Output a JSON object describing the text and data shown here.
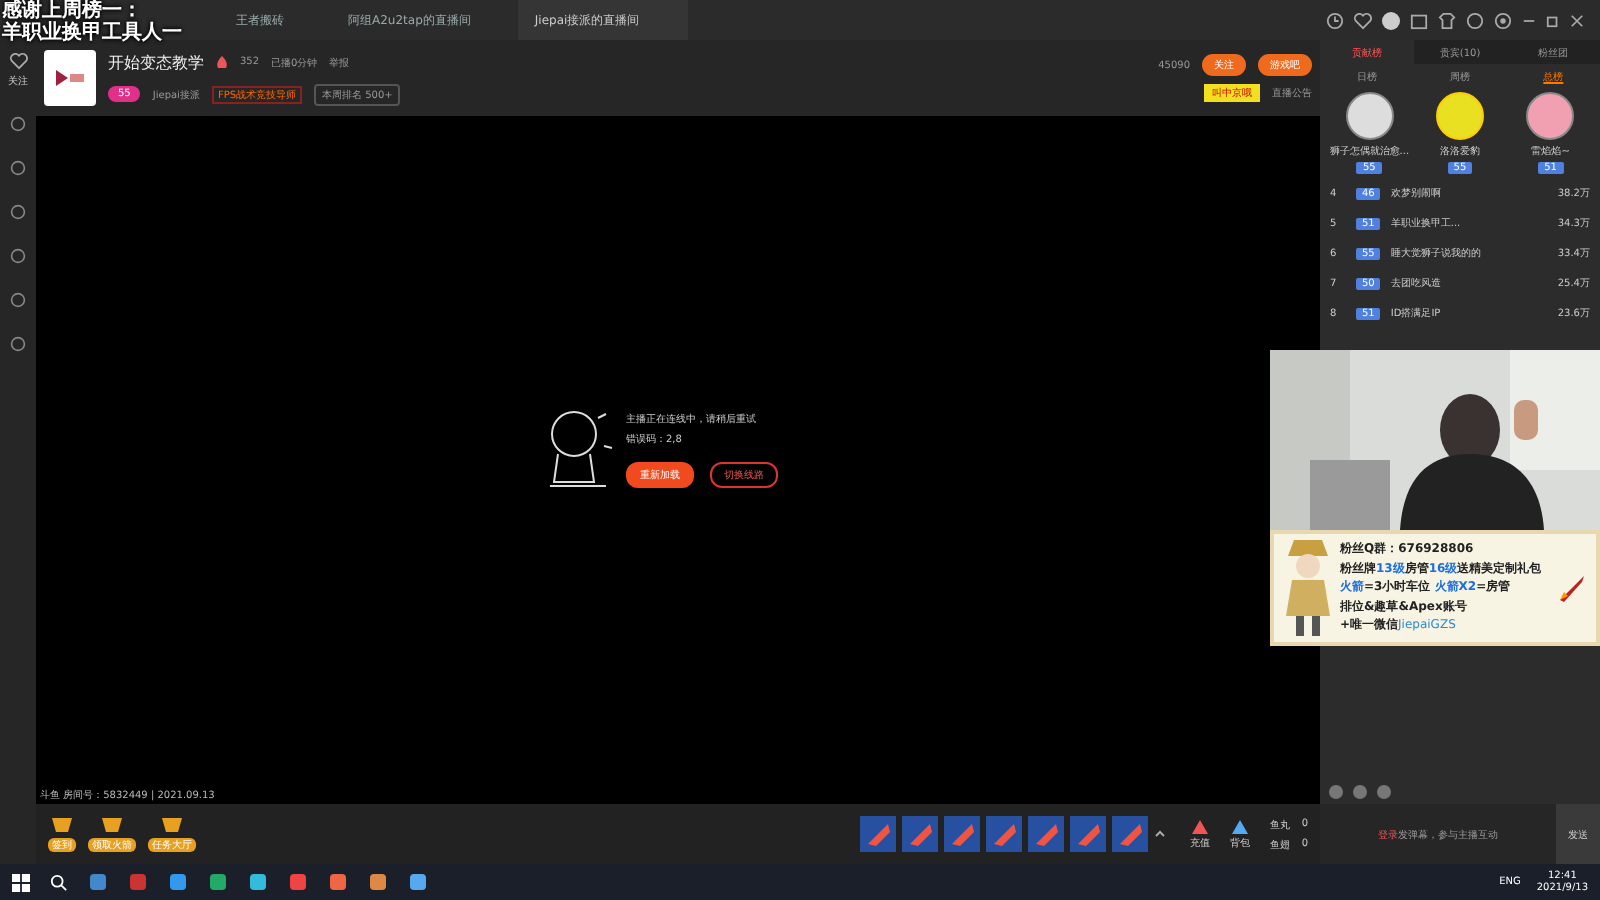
{
  "overlay_caption": [
    "感谢上周榜一：",
    "羊职业换甲工具人一"
  ],
  "browser_tabs": [
    {
      "label": "王者搬砖",
      "selected": false
    },
    {
      "label": "阿组A2u2tap的直播间",
      "selected": false
    },
    {
      "label": "Jiepai接派的直播间",
      "selected": true
    }
  ],
  "rail_label": "关注",
  "room": {
    "title": "开始变态教学",
    "heat": "352",
    "duration": "已播0分钟",
    "report": "举报",
    "level": "55",
    "anchor": "Jiepai接派",
    "tag": "FPS战术竞技导师",
    "rank": "本周排名 500+",
    "followers": "45090",
    "follow_button": "关注",
    "game_button": "游戏吧",
    "badge": "叫中京哦",
    "notice": "直播公告"
  },
  "player": {
    "message": "主播正在连线中，请稍后重试",
    "error_code": "错误码：2,8",
    "buttons": [
      "重新加载",
      "切换线路"
    ]
  },
  "info_line": "斗鱼 房间号：5832449 | 2021.09.13",
  "gift_bar": {
    "left": [
      "签到",
      "领取火箭",
      "任务大厅"
    ],
    "right": [
      "充值",
      "背包"
    ],
    "balances": [
      {
        "label": "鱼丸",
        "value": "0"
      },
      {
        "label": "鱼翅",
        "value": "0"
      }
    ]
  },
  "panel_tabs": [
    {
      "label": "贡献榜",
      "selected": true
    },
    {
      "label": "贵宾(10)",
      "selected": false
    },
    {
      "label": "粉丝团",
      "selected": false
    }
  ],
  "sub_tabs": [
    {
      "label": "日榜",
      "selected": false
    },
    {
      "label": "周榜",
      "selected": false
    },
    {
      "label": "总榜",
      "selected": true
    }
  ],
  "top3": [
    {
      "name": "狮子怎偶就治愈...",
      "level": "55"
    },
    {
      "name": "洛洛爱豹",
      "level": "55"
    },
    {
      "name": "雷焰焰~",
      "level": "51"
    }
  ],
  "ranks": [
    {
      "rank": "4",
      "level": "46",
      "name": "欢梦别闹啊",
      "score": "38.2万"
    },
    {
      "rank": "5",
      "level": "51",
      "name": "羊职业换甲工...",
      "score": "34.3万"
    },
    {
      "rank": "6",
      "level": "55",
      "name": "睡大觉狮子说我的的",
      "score": "33.4万"
    },
    {
      "rank": "7",
      "level": "50",
      "name": "去团吃风造",
      "score": "25.4万"
    },
    {
      "rank": "8",
      "level": "51",
      "name": "ID搭满足IP",
      "score": "23.6万"
    }
  ],
  "banner_lines": [
    [
      {
        "text": "粉丝Q群：",
        "kind": "plain"
      },
      {
        "text": "676928806",
        "kind": "plain"
      }
    ],
    [
      {
        "text": "粉丝牌",
        "kind": "plain"
      },
      {
        "text": "13级",
        "kind": "highlight"
      },
      {
        "text": "房管",
        "kind": "plain"
      },
      {
        "text": "16级",
        "kind": "highlight"
      },
      {
        "text": "送精美定制礼包",
        "kind": "plain"
      }
    ],
    [
      {
        "text": "火箭",
        "kind": "highlight"
      },
      {
        "text": "=3小时车位",
        "kind": "plain"
      },
      {
        "text": " 火箭X2",
        "kind": "highlight"
      },
      {
        "text": "=房管",
        "kind": "plain"
      }
    ],
    [
      {
        "text": "排位&趣草&Apex账号",
        "kind": "plain"
      }
    ],
    [
      {
        "text": "+唯一微信",
        "kind": "plain"
      },
      {
        "text": "JiepaiGZS",
        "kind": "wechat"
      }
    ]
  ],
  "chat": {
    "login": "登录",
    "placeholder": "发弹幕，参与主播互动",
    "send": "发送"
  },
  "taskbar": {
    "lang": "ENG",
    "time": "12:41",
    "date": "2021/9/13"
  }
}
